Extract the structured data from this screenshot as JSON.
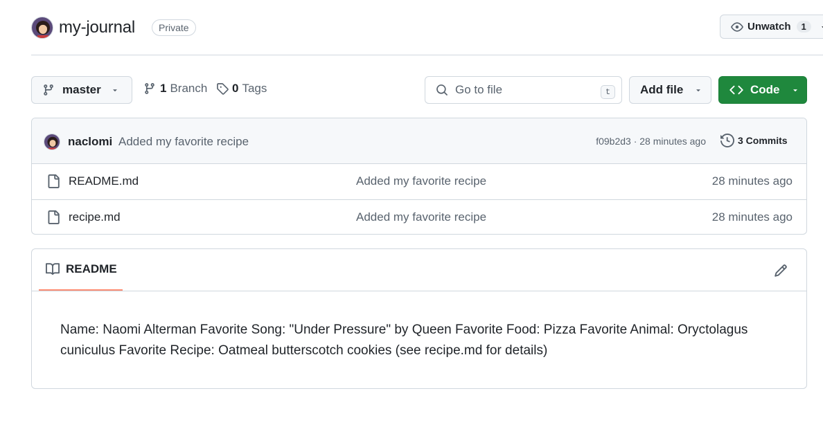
{
  "repo": {
    "name": "my-journal",
    "visibility": "Private"
  },
  "watch": {
    "label": "Unwatch",
    "count": "1"
  },
  "toolbar": {
    "branch": "master",
    "branch_count": "1",
    "branch_label": "Branch",
    "tag_count": "0",
    "tag_label": "Tags",
    "search_placeholder": "Go to file",
    "search_shortcut": "t",
    "add_file_label": "Add file",
    "code_label": "Code"
  },
  "latest_commit": {
    "author": "naclomi",
    "message": "Added my favorite recipe",
    "meta": "f09b2d3 · 28 minutes ago",
    "commits_label": "3 Commits"
  },
  "files": [
    {
      "name": "README.md",
      "commit": "Added my favorite recipe",
      "age": "28 minutes ago"
    },
    {
      "name": "recipe.md",
      "commit": "Added my favorite recipe",
      "age": "28 minutes ago"
    }
  ],
  "readme": {
    "tab_label": "README",
    "content": "Name: Naomi Alterman Favorite Song: \"Under Pressure\" by Queen Favorite Food: Pizza Favorite Animal: Oryctolagus cuniculus Favorite Recipe: Oatmeal butterscotch cookies (see recipe.md for details)"
  },
  "colors": {
    "accent_green": "#1f883d",
    "tab_underline": "#fd8c73",
    "border": "#d0d7de",
    "muted_text": "#59636e"
  },
  "icons": [
    "avatar",
    "eye-icon",
    "chevron-down-icon",
    "git-branch-icon",
    "tag-icon",
    "search-icon",
    "code-icon",
    "history-icon",
    "file-icon",
    "book-icon",
    "pencil-icon"
  ]
}
